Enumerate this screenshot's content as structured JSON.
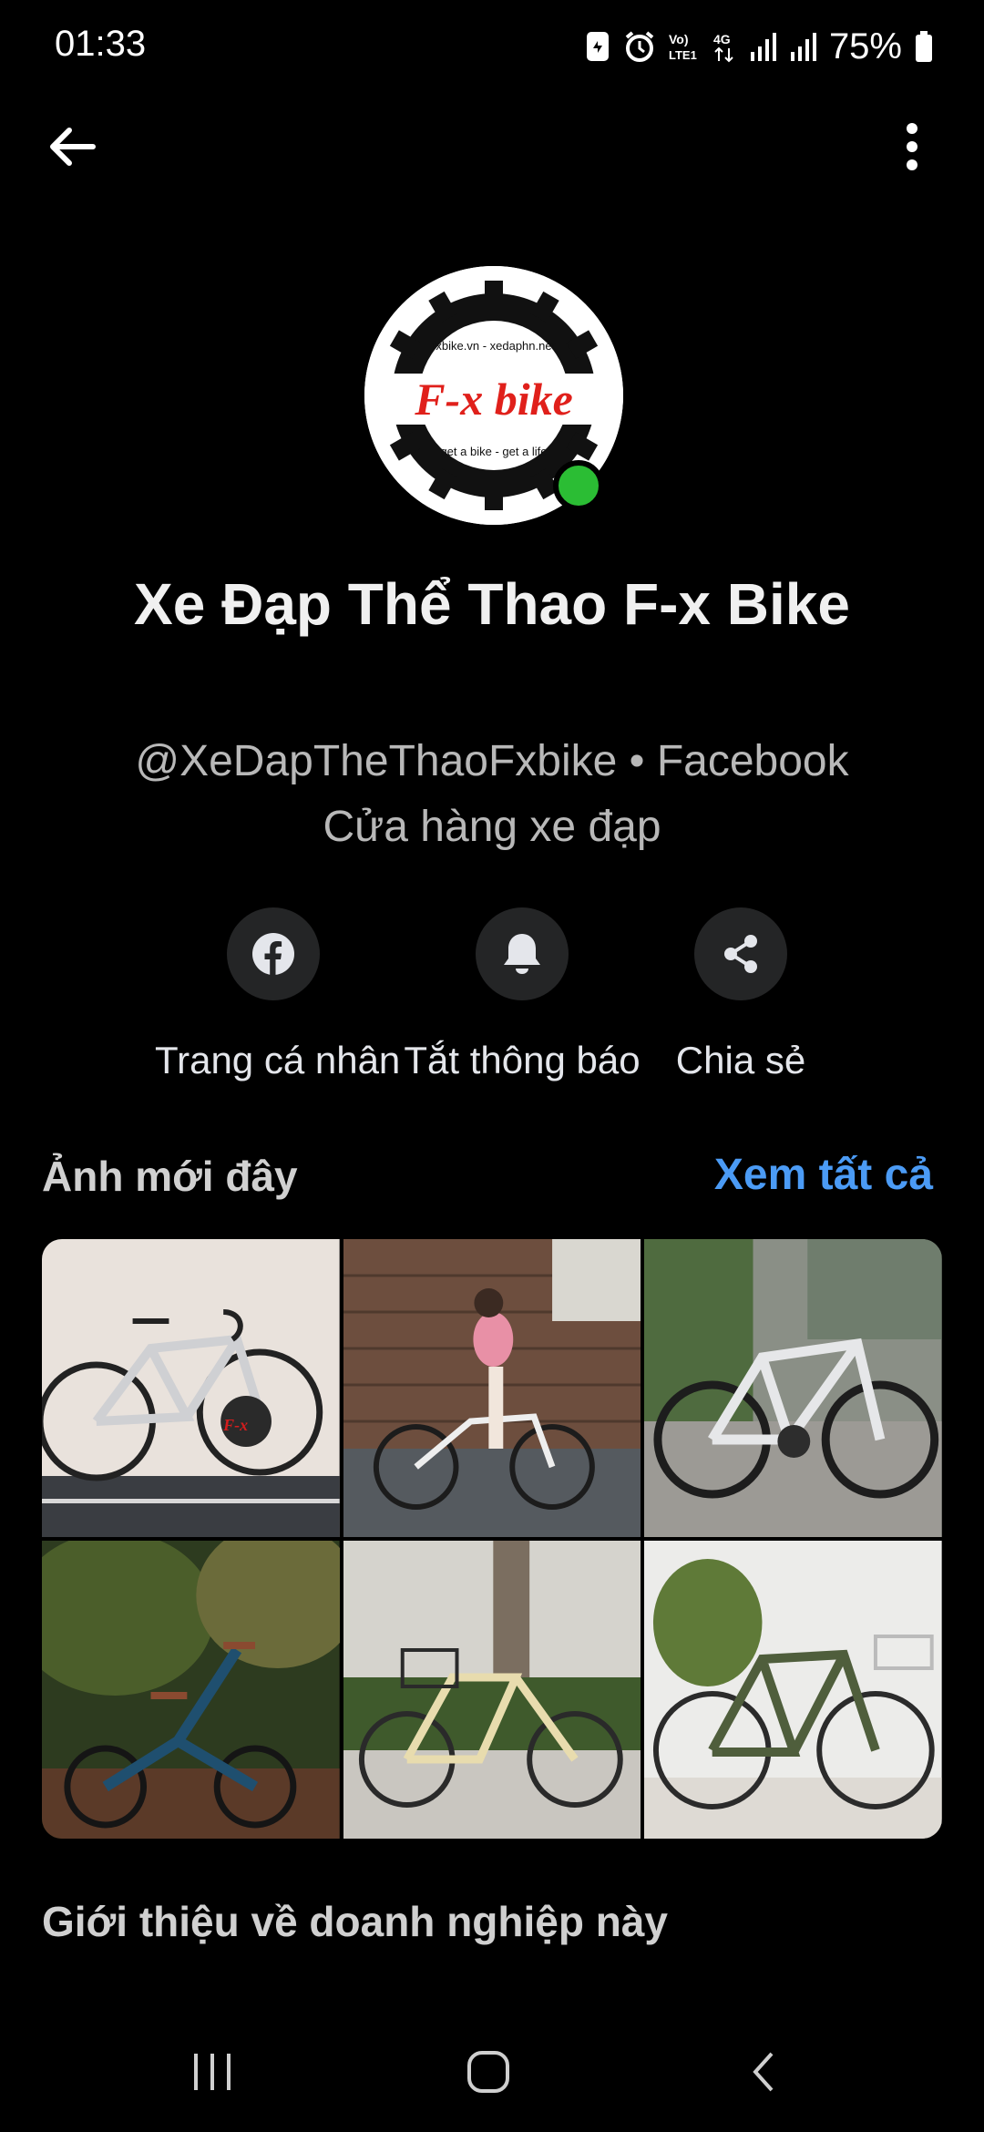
{
  "status_bar": {
    "time": "01:33",
    "battery": "75%"
  },
  "profile": {
    "logo_text": "F-x bike",
    "logo_top_text": "fxbike.vn - xedaphn.net",
    "logo_bottom_text": "get a bike - get a life",
    "name": "Xe Đạp Thể Thao F-x Bike",
    "handle": "@XeDapTheThaoFxbike • Facebook",
    "category": "Cửa hàng xe đạp",
    "online": true
  },
  "actions": [
    {
      "label": "Trang cá nhân",
      "icon": "facebook-icon"
    },
    {
      "label": "Tắt thông báo",
      "icon": "bell-icon"
    },
    {
      "label": "Chia sẻ",
      "icon": "share-icon"
    }
  ],
  "recent_photos": {
    "title": "Ảnh mới đây",
    "see_all": "Xem tất cả",
    "count": 6
  },
  "about": {
    "title": "Giới thiệu về doanh nghiệp này"
  },
  "colors": {
    "background": "#000000",
    "accent": "#4b9bf5",
    "online": "#2bbd34",
    "logo_red": "#e0201b"
  }
}
